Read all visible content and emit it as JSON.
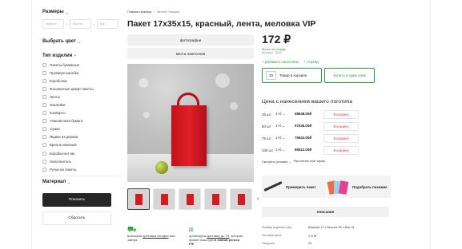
{
  "sidebar": {
    "sizes_label": "Размеры",
    "dims": [
      {
        "placeholder": "Ширина"
      },
      {
        "placeholder": "Высота"
      },
      {
        "placeholder": "Бок"
      }
    ],
    "dim_sep": "×",
    "color_label": "Выбрать цвет",
    "type_label": "Тип изделия",
    "types": [
      "Пакеты бумажные",
      "Премиум коробки",
      "Коробочки",
      "Фасовочные крафт-пакеты",
      "Ленты",
      "Наклейки",
      "Конверты",
      "Упаковочная бумага",
      "Сумки",
      "Ящики из дерева",
      "Брелок кожаный",
      "Коробка-кетчак",
      "Наполнитель",
      "Ручки на пакеты"
    ],
    "material_label": "Материал",
    "show_button": "Показать",
    "reset_button": "Сбросить"
  },
  "breadcrumb": {
    "home": "Главная страница",
    "sep": "/",
    "current": "Каталог товаров"
  },
  "product": {
    "title": "Пакет 17х35х15, красный, лента, меловка VIP",
    "price": "172 ₽",
    "stock": "Мало на складе",
    "article": "Артикул: 1522",
    "add_print": "+ Добавить нанесение",
    "add_atrif": "+ Атрейд",
    "qty": "10",
    "in_cart": "Товар в корзине",
    "one_click": "Купить в один клик"
  },
  "tabs": {
    "photos": "фотографии",
    "places": "места нанесения"
  },
  "thumb_next": "›",
  "features": {
    "f1_a": "возможна ",
    "f1_link": "доставка сегодня",
    "f1_b": " или завтра",
    "f2_a": "организуем ",
    "f2_link": "доставку до ТК",
    "f2_b": ", которая примет ваш груз ",
    "f2_bold": "в любой регион РФ"
  },
  "logo_pricing": {
    "heading": "Цена с нанесением вашего логотипа",
    "rows": [
      {
        "qty": "25 шт",
        "colors": "1+0",
        "price": "58548.00₽",
        "btn": "В корзину"
      },
      {
        "qty": "50 шт",
        "colors": "1+0",
        "price": "67536.00₽",
        "btn": "В корзину"
      },
      {
        "qty": "75 шт",
        "colors": "1+0",
        "price": "76524.00₽",
        "btn": "В корзину"
      },
      {
        "qty": "100 шт",
        "colors": "1+0",
        "price": "85512.00₽",
        "btn": "В корзину"
      }
    ],
    "conditions": "Смотреть условия",
    "count_tirage": "Рассчитать мой тираж"
  },
  "promos": {
    "try": "Примерить пакет",
    "similar": "Подобрать похожие"
  },
  "description_tab": "описание",
  "specs": [
    {
      "k": "Размер изделия (см):",
      "v": "Ширина 17 x Высота 35 x Бок 15"
    },
    {
      "k": "Оптовая цена",
      "v": "172 ₽"
    },
    {
      "k": "Нагрузка",
      "v": "20"
    }
  ],
  "colors": {
    "accent": "#2ba33a",
    "cart_red": "#e5363c",
    "bag_red": "#d41a22",
    "dark_button": "#262626"
  }
}
